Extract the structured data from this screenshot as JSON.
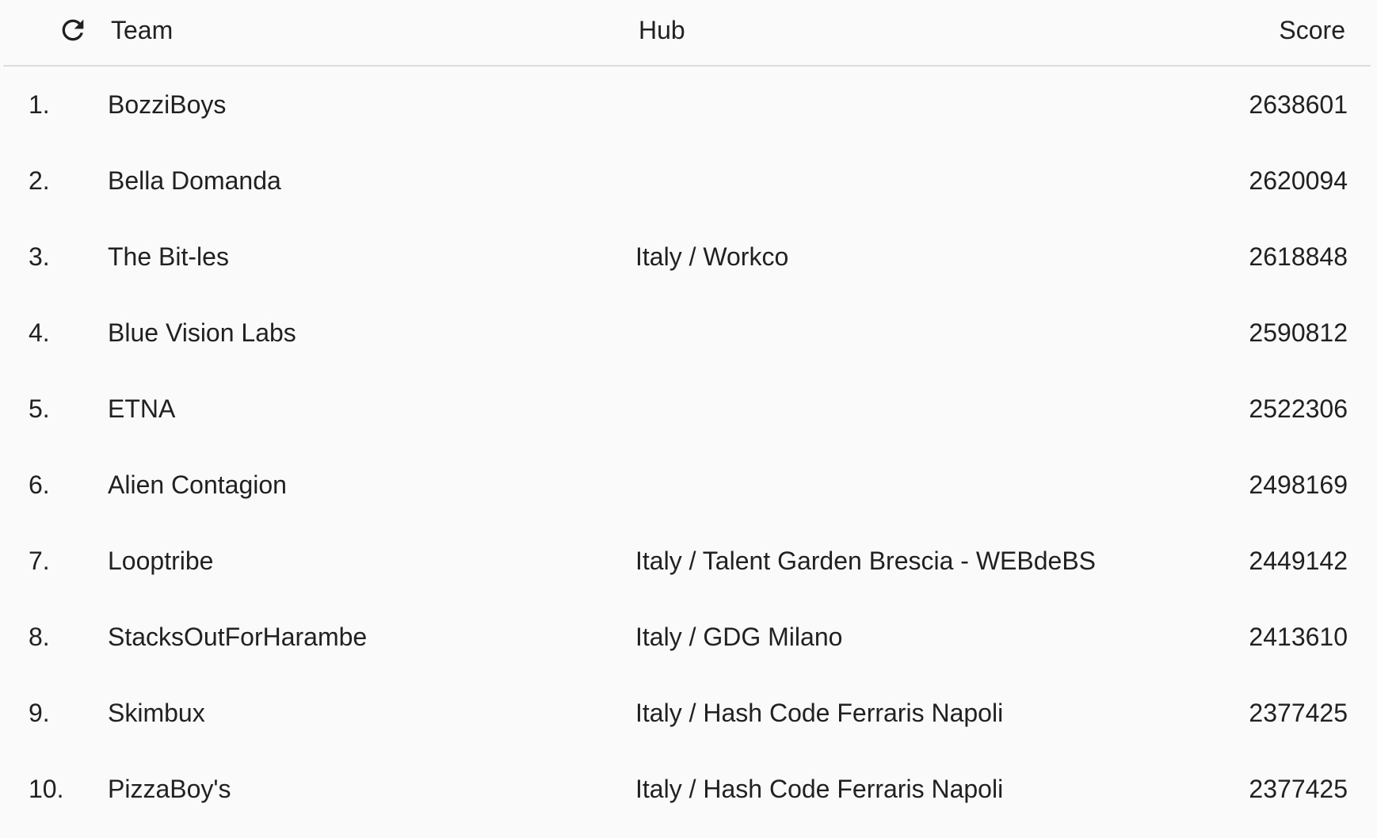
{
  "header": {
    "refresh_icon": "refresh-icon",
    "team_label": "Team",
    "hub_label": "Hub",
    "score_label": "Score"
  },
  "rows": [
    {
      "rank": "1.",
      "team": "BozziBoys",
      "hub": "",
      "score": "2638601"
    },
    {
      "rank": "2.",
      "team": "Bella Domanda",
      "hub": "",
      "score": "2620094"
    },
    {
      "rank": "3.",
      "team": "The Bit-les",
      "hub": "Italy / Workco",
      "score": "2618848"
    },
    {
      "rank": "4.",
      "team": "Blue Vision Labs",
      "hub": "",
      "score": "2590812"
    },
    {
      "rank": "5.",
      "team": "ETNA",
      "hub": "",
      "score": "2522306"
    },
    {
      "rank": "6.",
      "team": "Alien Contagion",
      "hub": "",
      "score": "2498169"
    },
    {
      "rank": "7.",
      "team": "Looptribe",
      "hub": "Italy / Talent Garden Brescia - WEBdeBS",
      "score": "2449142"
    },
    {
      "rank": "8.",
      "team": "StacksOutForHarambe",
      "hub": "Italy / GDG Milano",
      "score": "2413610"
    },
    {
      "rank": "9.",
      "team": "Skimbux",
      "hub": "Italy / Hash Code Ferraris Napoli",
      "score": "2377425"
    },
    {
      "rank": "10.",
      "team": "PizzaBoy's",
      "hub": "Italy / Hash Code Ferraris Napoli",
      "score": "2377425"
    }
  ]
}
